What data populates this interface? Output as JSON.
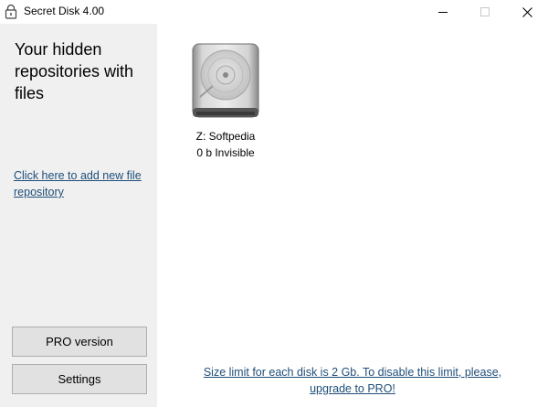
{
  "window": {
    "title": "Secret Disk 4.00",
    "icons": {
      "app": "lock-icon",
      "minimize": "minimize-icon",
      "maximize": "maximize-icon",
      "close": "close-icon"
    }
  },
  "sidebar": {
    "heading": "Your hidden repositories with files",
    "add_link": "Click here to add new file repository",
    "pro_button": "PRO version",
    "settings_button": "Settings"
  },
  "main": {
    "disks": [
      {
        "name": "Z: Softpedia",
        "status": "0 b Invisible",
        "icon": "hard-drive-icon"
      }
    ],
    "limit_notice": {
      "line1": "Size limit for each disk is 2 Gb. To disable this limit, please,",
      "line2": "upgrade to PRO!"
    }
  },
  "colors": {
    "sidebar_bg": "#f0f0f0",
    "link": "#1f4e79",
    "button_bg": "#e1e1e1"
  }
}
